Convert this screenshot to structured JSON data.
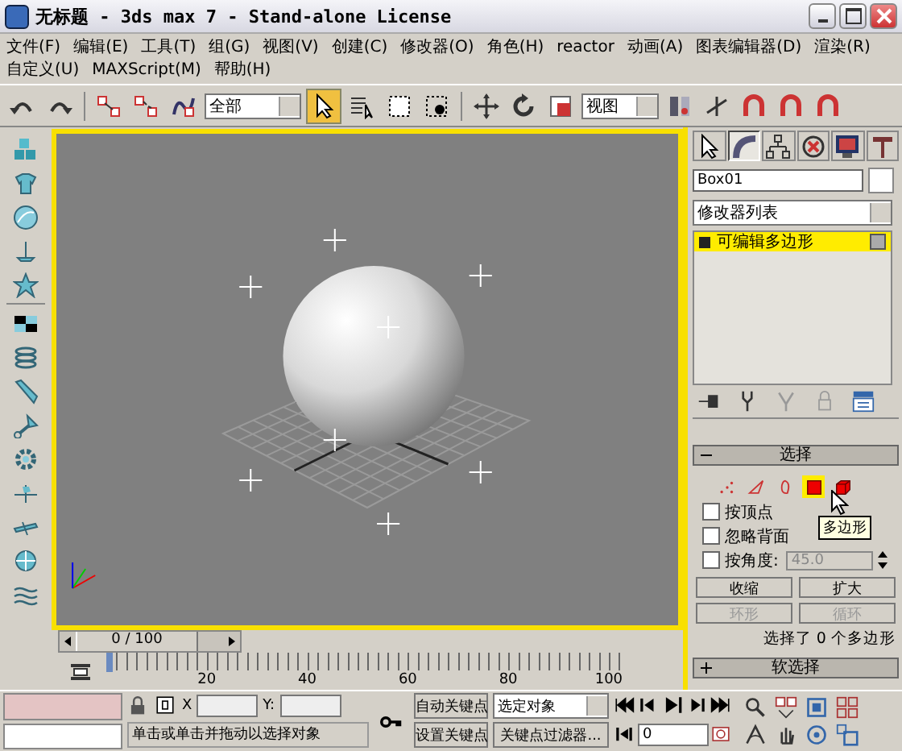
{
  "window": {
    "title": "无标题 - 3ds max 7 - Stand-alone License"
  },
  "menu_rows": [
    [
      "文件(F)",
      "编辑(E)",
      "工具(T)",
      "组(G)",
      "视图(V)",
      "创建(C)",
      "修改器(O)",
      "角色(H)",
      "reactor",
      "动画(A)",
      "图表编辑器(D)",
      "渲染(R)"
    ],
    [
      "自定义(U)",
      "MAXScript(M)",
      "帮助(H)"
    ]
  ],
  "toolbar": {
    "selection_filter": "全部",
    "reference_coord": "视图"
  },
  "command_panel": {
    "tabs": [
      {
        "selected": false
      },
      {
        "selected": true
      },
      {
        "selected": false
      },
      {
        "selected": false
      },
      {
        "selected": false
      },
      {
        "selected": false
      }
    ],
    "object_name": "Box01",
    "modifier_list": "修改器列表",
    "stack": [
      {
        "label": "可编辑多边形",
        "selected": true
      }
    ],
    "rollouts": [
      {
        "title": "选择",
        "expanded": true
      },
      {
        "title": "软选择",
        "expanded": false
      }
    ],
    "levels": [
      {
        "selected": false
      },
      {
        "selected": false
      },
      {
        "selected": false
      },
      {
        "selected": true
      },
      {
        "selected": false
      }
    ],
    "checkboxes": [
      {
        "label": "按顶点",
        "checked": false
      },
      {
        "label": "忽略背面",
        "checked": false
      },
      {
        "label": "按角度:",
        "checked": false,
        "value": "45.0",
        "disabled": true
      }
    ],
    "buttons": [
      {
        "label": "收缩",
        "disabled": false
      },
      {
        "label": "扩大",
        "disabled": false
      },
      {
        "label": "环形",
        "disabled": true
      },
      {
        "label": "循环",
        "disabled": true
      }
    ],
    "selection_status": "选择了 0 个多边形",
    "tooltip": "多边形"
  },
  "timeline": {
    "slider": "0 / 100",
    "level": 0,
    "ruler_labels": [
      "20",
      "40",
      "60",
      "80",
      "100"
    ]
  },
  "status_bar": {
    "x_label": "X",
    "y_label": "Y:",
    "prompt": "单击或单击并拖动以选择对象",
    "auto_key": "自动关键点",
    "set_key": "设置关键点",
    "key_target": "选定对象",
    "key_filters": "关键点过滤器...",
    "frame": "0"
  }
}
